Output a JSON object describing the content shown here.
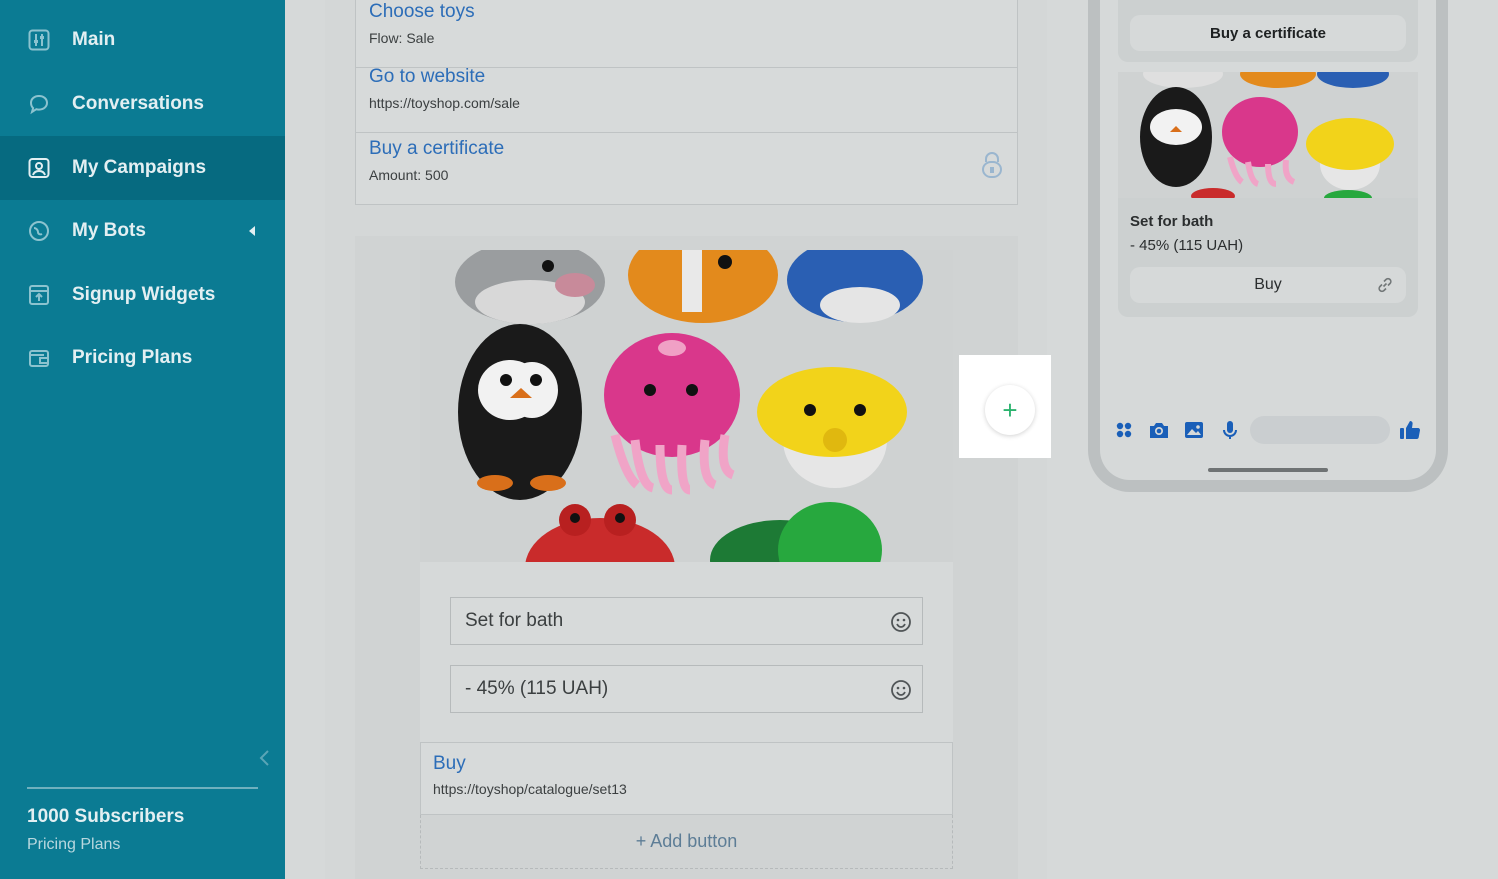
{
  "sidebar": {
    "items": [
      {
        "label": "Main",
        "icon": "sliders-icon"
      },
      {
        "label": "Conversations",
        "icon": "chat-icon"
      },
      {
        "label": "My Campaigns",
        "icon": "campaign-icon"
      },
      {
        "label": "My Bots",
        "icon": "bot-icon"
      },
      {
        "label": "Signup Widgets",
        "icon": "widget-icon"
      },
      {
        "label": "Pricing Plans",
        "icon": "wallet-icon"
      }
    ],
    "active_item": "My Campaigns",
    "subscribers": "1000 Subscribers",
    "plans_link": "Pricing Plans"
  },
  "editor": {
    "buttons": [
      {
        "title": "Choose toys",
        "sub": "Flow: Sale"
      },
      {
        "title": "Go to website",
        "sub": "https://toyshop.com/sale"
      },
      {
        "title": "Buy a certificate",
        "sub": "Amount: 500"
      }
    ],
    "card": {
      "title_value": "Set for bath",
      "subtitle_value": "- 45% (115 UAH)",
      "button_title": "Buy",
      "button_url": "https://toyshop/catalogue/set13",
      "add_button": "+ Add button"
    },
    "add_card_symbol": "+"
  },
  "preview": {
    "button": "Buy a certificate",
    "card_title": "Set for bath",
    "card_subtitle": "- 45% (115 UAH)",
    "card_button": "Buy"
  },
  "colors": {
    "sidebar": "#0b7b93",
    "link": "#2c6db8",
    "accent_green": "#2bb36e",
    "messenger_blue": "#1877f2"
  }
}
